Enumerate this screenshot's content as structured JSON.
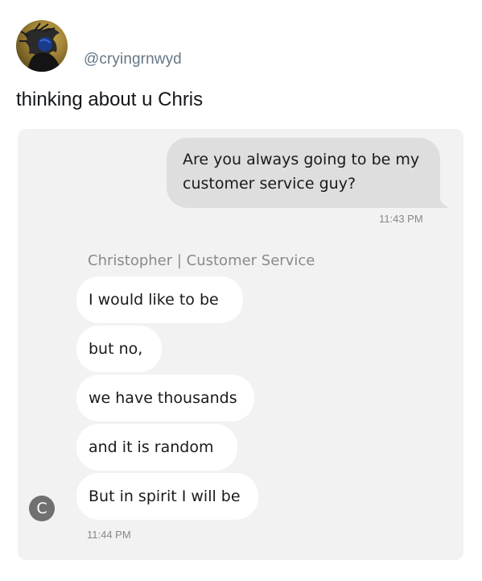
{
  "tweet": {
    "handle": "@cryingrnwyd",
    "text": "thinking about u Chris",
    "avatar_icon": "profile-photo"
  },
  "chat": {
    "sent_message": "Are you always going to be my customer service guy?",
    "sent_time": "11:43 PM",
    "sender_name": "Christopher | Customer Service",
    "sender_initial": "C",
    "received_messages": [
      "I would like to be",
      "but no,",
      "we have thousands",
      "and it is random",
      "But in spirit I will be"
    ],
    "received_time": "11:44 PM"
  },
  "colors": {
    "chat_background": "#f2f2f2",
    "sent_bubble": "#dedede",
    "received_bubble": "#ffffff",
    "handle_gray": "#657786",
    "initial_avatar": "#707070"
  }
}
